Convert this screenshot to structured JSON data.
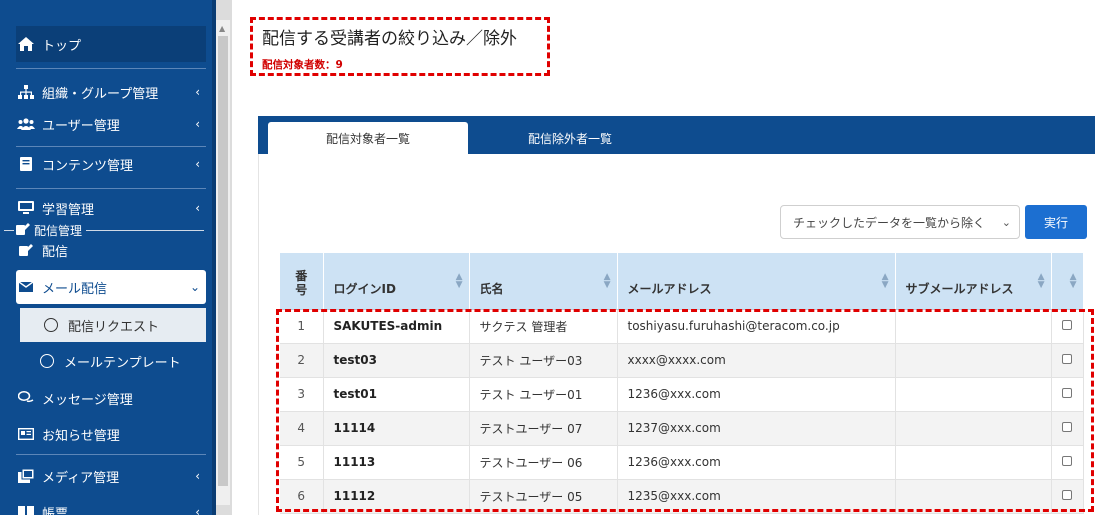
{
  "sidebar": {
    "top": {
      "label": "トップ",
      "icon": "home-icon"
    },
    "items": [
      {
        "label": "組織・グループ管理",
        "icon": "org-chart-icon"
      },
      {
        "label": "ユーザー管理",
        "icon": "users-icon"
      },
      {
        "label": "コンテンツ管理",
        "icon": "book-icon"
      },
      {
        "label": "学習管理",
        "icon": "learning-icon"
      },
      {
        "label": "配信",
        "icon": "share-icon"
      },
      {
        "label": "メール配信",
        "icon": "envelope-icon"
      },
      {
        "label": "配信リクエスト",
        "icon": "circle-icon"
      },
      {
        "label": "メールテンプレート",
        "icon": "circle-icon"
      },
      {
        "label": "メッセージ管理",
        "icon": "chat-icon"
      },
      {
        "label": "お知らせ管理",
        "icon": "newspaper-icon"
      },
      {
        "label": "メディア管理",
        "icon": "media-icon"
      },
      {
        "label": "帳票",
        "icon": "report-icon"
      }
    ],
    "overlay_label": "配信管理"
  },
  "page": {
    "title": "配信する受講者の絞り込み／除外",
    "count_text": "配信対象者数：9"
  },
  "tabs": [
    {
      "label": "配信対象者一覧"
    },
    {
      "label": "配信除外者一覧"
    }
  ],
  "bulk_action": {
    "selected": "チェックしたデータを一覧から除く",
    "run_label": "実行"
  },
  "table": {
    "headers": [
      "番号",
      "ログインID",
      "氏名",
      "メールアドレス",
      "サブメールアドレス",
      ""
    ],
    "rows": [
      {
        "no": "1",
        "login": "SAKUTES-admin",
        "name": "サクテス 管理者",
        "email": "toshiyasu.furuhashi@teracom.co.jp",
        "sub": ""
      },
      {
        "no": "2",
        "login": "test03",
        "name": "テスト ユーザー03",
        "email": "xxxx@xxxx.com",
        "sub": ""
      },
      {
        "no": "3",
        "login": "test01",
        "name": "テスト ユーザー01",
        "email": "1236@xxx.com",
        "sub": ""
      },
      {
        "no": "4",
        "login": "11114",
        "name": "テストユーザー 07",
        "email": "1237@xxx.com",
        "sub": ""
      },
      {
        "no": "5",
        "login": "11113",
        "name": "テストユーザー 06",
        "email": "1236@xxx.com",
        "sub": ""
      },
      {
        "no": "6",
        "login": "11112",
        "name": "テストユーザー 05",
        "email": "1235@xxx.com",
        "sub": ""
      }
    ]
  },
  "colors": {
    "sidebar_bg": "#0e4c8f",
    "header_bg": "#cde2f4",
    "accent": "#1c6fd1",
    "highlight": "#e00000"
  }
}
